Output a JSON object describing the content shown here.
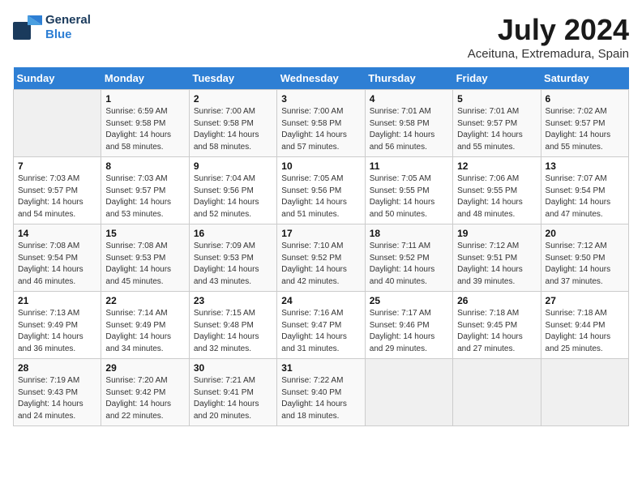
{
  "header": {
    "logo_line1": "General",
    "logo_line2": "Blue",
    "title": "July 2024",
    "subtitle": "Aceituna, Extremadura, Spain"
  },
  "calendar": {
    "weekdays": [
      "Sunday",
      "Monday",
      "Tuesday",
      "Wednesday",
      "Thursday",
      "Friday",
      "Saturday"
    ],
    "weeks": [
      [
        {
          "day": "",
          "info": ""
        },
        {
          "day": "1",
          "info": "Sunrise: 6:59 AM\nSunset: 9:58 PM\nDaylight: 14 hours\nand 58 minutes."
        },
        {
          "day": "2",
          "info": "Sunrise: 7:00 AM\nSunset: 9:58 PM\nDaylight: 14 hours\nand 58 minutes."
        },
        {
          "day": "3",
          "info": "Sunrise: 7:00 AM\nSunset: 9:58 PM\nDaylight: 14 hours\nand 57 minutes."
        },
        {
          "day": "4",
          "info": "Sunrise: 7:01 AM\nSunset: 9:58 PM\nDaylight: 14 hours\nand 56 minutes."
        },
        {
          "day": "5",
          "info": "Sunrise: 7:01 AM\nSunset: 9:57 PM\nDaylight: 14 hours\nand 55 minutes."
        },
        {
          "day": "6",
          "info": "Sunrise: 7:02 AM\nSunset: 9:57 PM\nDaylight: 14 hours\nand 55 minutes."
        }
      ],
      [
        {
          "day": "7",
          "info": "Sunrise: 7:03 AM\nSunset: 9:57 PM\nDaylight: 14 hours\nand 54 minutes."
        },
        {
          "day": "8",
          "info": "Sunrise: 7:03 AM\nSunset: 9:57 PM\nDaylight: 14 hours\nand 53 minutes."
        },
        {
          "day": "9",
          "info": "Sunrise: 7:04 AM\nSunset: 9:56 PM\nDaylight: 14 hours\nand 52 minutes."
        },
        {
          "day": "10",
          "info": "Sunrise: 7:05 AM\nSunset: 9:56 PM\nDaylight: 14 hours\nand 51 minutes."
        },
        {
          "day": "11",
          "info": "Sunrise: 7:05 AM\nSunset: 9:55 PM\nDaylight: 14 hours\nand 50 minutes."
        },
        {
          "day": "12",
          "info": "Sunrise: 7:06 AM\nSunset: 9:55 PM\nDaylight: 14 hours\nand 48 minutes."
        },
        {
          "day": "13",
          "info": "Sunrise: 7:07 AM\nSunset: 9:54 PM\nDaylight: 14 hours\nand 47 minutes."
        }
      ],
      [
        {
          "day": "14",
          "info": "Sunrise: 7:08 AM\nSunset: 9:54 PM\nDaylight: 14 hours\nand 46 minutes."
        },
        {
          "day": "15",
          "info": "Sunrise: 7:08 AM\nSunset: 9:53 PM\nDaylight: 14 hours\nand 45 minutes."
        },
        {
          "day": "16",
          "info": "Sunrise: 7:09 AM\nSunset: 9:53 PM\nDaylight: 14 hours\nand 43 minutes."
        },
        {
          "day": "17",
          "info": "Sunrise: 7:10 AM\nSunset: 9:52 PM\nDaylight: 14 hours\nand 42 minutes."
        },
        {
          "day": "18",
          "info": "Sunrise: 7:11 AM\nSunset: 9:52 PM\nDaylight: 14 hours\nand 40 minutes."
        },
        {
          "day": "19",
          "info": "Sunrise: 7:12 AM\nSunset: 9:51 PM\nDaylight: 14 hours\nand 39 minutes."
        },
        {
          "day": "20",
          "info": "Sunrise: 7:12 AM\nSunset: 9:50 PM\nDaylight: 14 hours\nand 37 minutes."
        }
      ],
      [
        {
          "day": "21",
          "info": "Sunrise: 7:13 AM\nSunset: 9:49 PM\nDaylight: 14 hours\nand 36 minutes."
        },
        {
          "day": "22",
          "info": "Sunrise: 7:14 AM\nSunset: 9:49 PM\nDaylight: 14 hours\nand 34 minutes."
        },
        {
          "day": "23",
          "info": "Sunrise: 7:15 AM\nSunset: 9:48 PM\nDaylight: 14 hours\nand 32 minutes."
        },
        {
          "day": "24",
          "info": "Sunrise: 7:16 AM\nSunset: 9:47 PM\nDaylight: 14 hours\nand 31 minutes."
        },
        {
          "day": "25",
          "info": "Sunrise: 7:17 AM\nSunset: 9:46 PM\nDaylight: 14 hours\nand 29 minutes."
        },
        {
          "day": "26",
          "info": "Sunrise: 7:18 AM\nSunset: 9:45 PM\nDaylight: 14 hours\nand 27 minutes."
        },
        {
          "day": "27",
          "info": "Sunrise: 7:18 AM\nSunset: 9:44 PM\nDaylight: 14 hours\nand 25 minutes."
        }
      ],
      [
        {
          "day": "28",
          "info": "Sunrise: 7:19 AM\nSunset: 9:43 PM\nDaylight: 14 hours\nand 24 minutes."
        },
        {
          "day": "29",
          "info": "Sunrise: 7:20 AM\nSunset: 9:42 PM\nDaylight: 14 hours\nand 22 minutes."
        },
        {
          "day": "30",
          "info": "Sunrise: 7:21 AM\nSunset: 9:41 PM\nDaylight: 14 hours\nand 20 minutes."
        },
        {
          "day": "31",
          "info": "Sunrise: 7:22 AM\nSunset: 9:40 PM\nDaylight: 14 hours\nand 18 minutes."
        },
        {
          "day": "",
          "info": ""
        },
        {
          "day": "",
          "info": ""
        },
        {
          "day": "",
          "info": ""
        }
      ]
    ]
  }
}
